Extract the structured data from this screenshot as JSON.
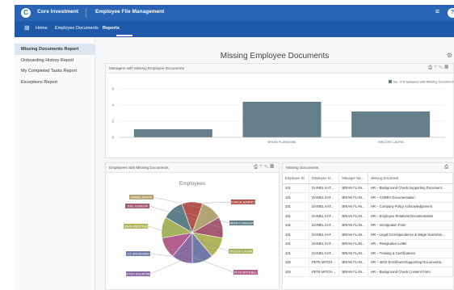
{
  "header": {
    "logo_letter": "C",
    "app_name": "Core Investment",
    "module_name": "Employee File Management",
    "menu_glyph": "≡",
    "user_glyph": "?"
  },
  "nav": {
    "grid_glyph": "⊞",
    "items": [
      {
        "label": "Home"
      },
      {
        "label": "Employee Documents"
      },
      {
        "label": "Reports"
      }
    ],
    "active": "Reports"
  },
  "sidebar": {
    "items": [
      {
        "label": "Missing Documents Report",
        "active": true
      },
      {
        "label": "Onboarding History Report",
        "active": false
      },
      {
        "label": "My Completed Tasks Report",
        "active": false
      },
      {
        "label": "Exceptions Report",
        "active": false
      }
    ]
  },
  "page": {
    "title": "Missing Employee Documents",
    "settings_glyph": "⚙"
  },
  "managers_panel": {
    "title": "Managers with Missing Employee Documents",
    "tools": [
      "⎙",
      "⊤",
      "✎",
      "▤"
    ]
  },
  "employees_panel": {
    "title": "Employees with Missing Documents",
    "tools": [
      "⎙",
      "⊤",
      "✎",
      "▤"
    ]
  },
  "documents_panel": {
    "title": "Missing Documents",
    "tools": [
      "⎙"
    ],
    "columns": [
      "Employee ID",
      "Employee N...",
      "Manager Na...",
      "Missing Document"
    ],
    "rows": [
      [
        "101",
        "DANIEL KAT...",
        "BRIAN FLAN...",
        "HR – Background Check Supporting Document..."
      ],
      [
        "101",
        "DANIEL KAT...",
        "BRIAN FLAN...",
        "HR – COBRA Documentation"
      ],
      [
        "101",
        "DANIEL KAT...",
        "BRIAN FLAN...",
        "HR – Company Policy Acknowledgement"
      ],
      [
        "101",
        "DANIEL KAT...",
        "BRIAN FLAN...",
        "HR – Employee Relations Documentation"
      ],
      [
        "101",
        "DANIEL KAT...",
        "BRIAN FLAN...",
        "HR – Immigration Form"
      ],
      [
        "101",
        "DANIEL KAT...",
        "BRIAN FLAN...",
        "HR – Legal Correspondence & Wage Garnishm..."
      ],
      [
        "101",
        "DANIEL KAT...",
        "BRIAN FLAN...",
        "HR – Resignation Letter"
      ],
      [
        "101",
        "DANIEL KAT...",
        "BRIAN FLAN...",
        "HR – Training & Certifications"
      ],
      [
        "102",
        "PETE MITCH...",
        "BRIAN FLAN...",
        "HR – 401K Enrollment/Supporting Documentat..."
      ],
      [
        "102",
        "PETE MITCH...",
        "BRIAN FLAN...",
        "HR – Background Check Consent Form"
      ]
    ]
  },
  "chart_data": [
    {
      "type": "bar",
      "title": "",
      "legend": [
        "No. of Employees with Missing Documents"
      ],
      "legend_position": "top-right",
      "categories": [
        "",
        "BRIAN FLANAGAN",
        "VINCENT LAURA"
      ],
      "values": [
        1,
        4.4,
        3.2
      ],
      "ylim": [
        0,
        6
      ],
      "yticks": [
        0,
        2,
        4,
        6
      ],
      "color": "#647f89",
      "grid": true
    },
    {
      "type": "pie",
      "title": "Employees",
      "labels": [
        "DANIEL KATTIS",
        "JOEL GORDON",
        "JOHN WEBSTER",
        "LIZ GROSSMAN",
        "MITCH MCENTIRE",
        "PETE MITCHELL",
        "VINCENT LAURA",
        "BRIAN FLANAGAN",
        "CHARLIE BARRETT"
      ],
      "values": [
        8,
        8,
        8,
        8,
        8,
        8,
        8,
        8,
        8
      ],
      "colors": [
        "#b4a472",
        "#a45a72",
        "#b2b45c",
        "#707aa9",
        "#8a6aa2",
        "#b35e8d",
        "#a5b35c",
        "#5e7f89",
        "#b6524c"
      ]
    }
  ]
}
